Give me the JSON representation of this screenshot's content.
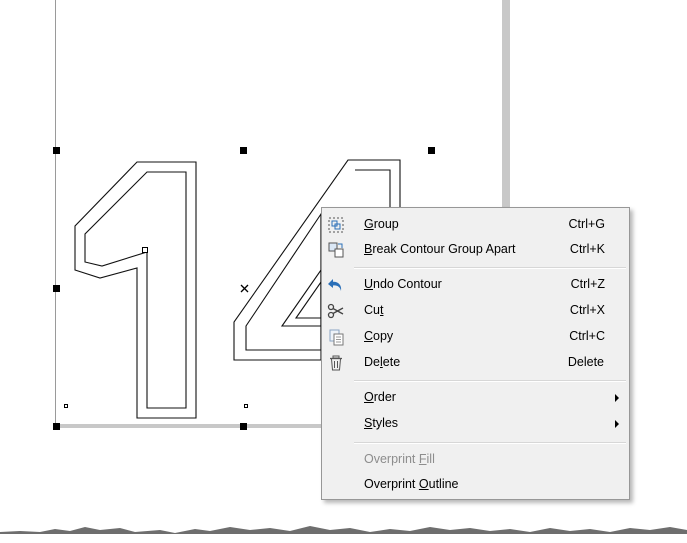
{
  "canvas": {
    "glyph_1": "1",
    "glyph_4": "4"
  },
  "context_menu": {
    "items": [
      {
        "pre": "",
        "key": "G",
        "post": "roup",
        "accel": "Ctrl+G",
        "icon": "group-icon"
      },
      {
        "pre": "",
        "key": "B",
        "post": "reak Contour Group Apart",
        "accel": "Ctrl+K",
        "icon": "break-apart-icon"
      },
      {
        "pre": "",
        "key": "U",
        "post": "ndo Contour",
        "accel": "Ctrl+Z",
        "icon": "undo-icon"
      },
      {
        "pre": "Cu",
        "key": "t",
        "post": "",
        "accel": "Ctrl+X",
        "icon": "scissors-icon"
      },
      {
        "pre": "",
        "key": "C",
        "post": "opy",
        "accel": "Ctrl+C",
        "icon": "copy-icon"
      },
      {
        "pre": "De",
        "key": "l",
        "post": "ete",
        "accel": "Delete",
        "icon": "trash-icon"
      },
      {
        "pre": "",
        "key": "O",
        "post": "rder",
        "accel": "",
        "icon": "",
        "submenu": true
      },
      {
        "pre": "",
        "key": "S",
        "post": "tyles",
        "accel": "",
        "icon": "",
        "submenu": true
      },
      {
        "pre": "Overprint ",
        "key": "F",
        "post": "ill",
        "accel": "",
        "icon": "",
        "disabled": true
      },
      {
        "pre": "Overprint ",
        "key": "O",
        "post": "utline",
        "accel": "",
        "icon": ""
      }
    ]
  },
  "colors": {
    "menu_bg": "#f0f0f0",
    "menu_border": "#979797",
    "disabled_text": "#8d8d8d",
    "accent_blue": "#2a6fb8"
  }
}
